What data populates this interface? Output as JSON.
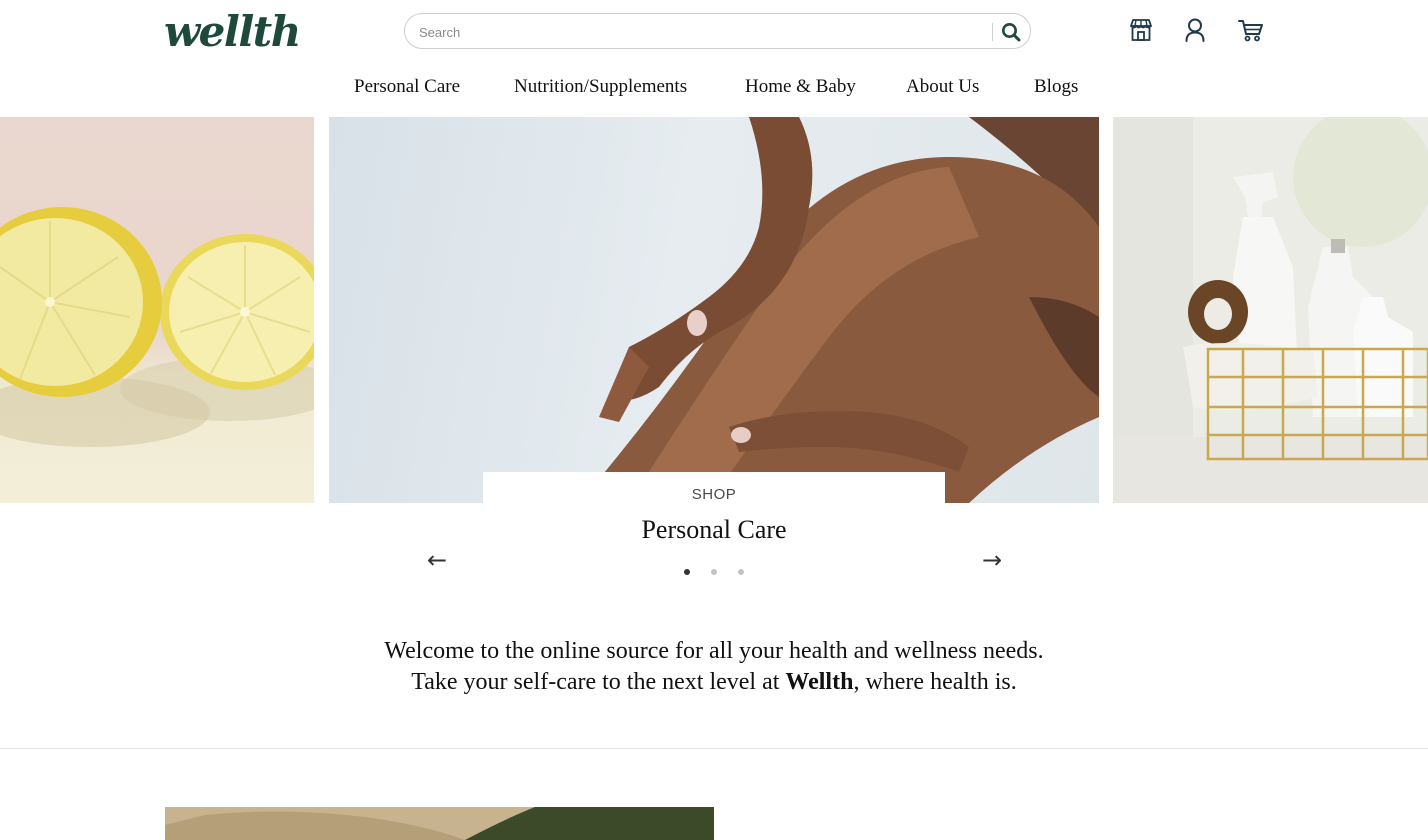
{
  "brand": {
    "logo": "wellth",
    "color": "#1f4a3a"
  },
  "search": {
    "placeholder": "Search",
    "value": ""
  },
  "header_icons": [
    "store-icon",
    "account-icon",
    "cart-icon"
  ],
  "nav": {
    "items": [
      {
        "label": "Personal Care"
      },
      {
        "label": "Nutrition/Supplements"
      },
      {
        "label": "Home & Baby"
      },
      {
        "label": "About Us"
      },
      {
        "label": "Blogs"
      }
    ]
  },
  "carousel": {
    "eyebrow": "SHOP",
    "title": "Personal Care",
    "prev": "←",
    "next": "→",
    "active_index": 0,
    "dot_count": 3
  },
  "welcome": {
    "line1": "Welcome to the online source for all your health and wellness needs.",
    "line2_prefix": "Take your self-care to the next level at ",
    "line2_brand": "Wellth",
    "line2_suffix": ", where health is."
  }
}
